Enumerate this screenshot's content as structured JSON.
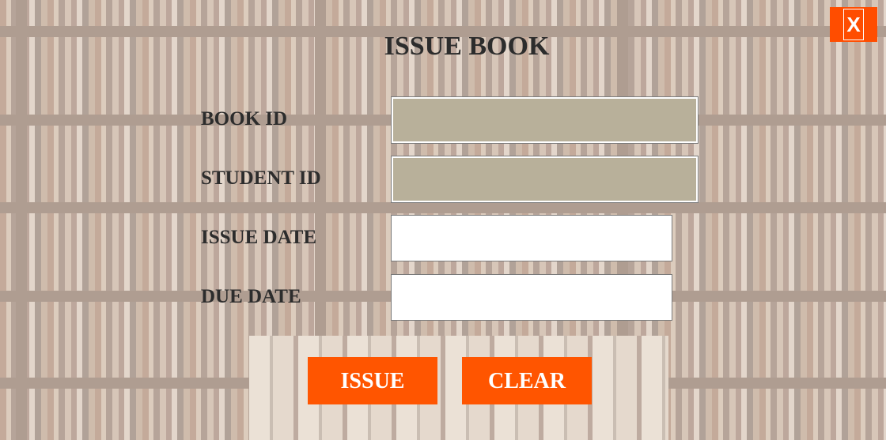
{
  "title": "ISSUE BOOK",
  "close_label": "X",
  "fields": {
    "book_id": {
      "label": "BOOK ID",
      "value": ""
    },
    "student_id": {
      "label": "STUDENT ID",
      "value": ""
    },
    "issue_date": {
      "label": "ISSUE DATE",
      "value": ""
    },
    "due_date": {
      "label": "DUE DATE",
      "value": ""
    }
  },
  "buttons": {
    "issue": "ISSUE",
    "clear": "CLEAR"
  },
  "colors": {
    "accent": "#ff5500",
    "disabled_field": "#b8b09a",
    "text": "#2c2c2c"
  }
}
